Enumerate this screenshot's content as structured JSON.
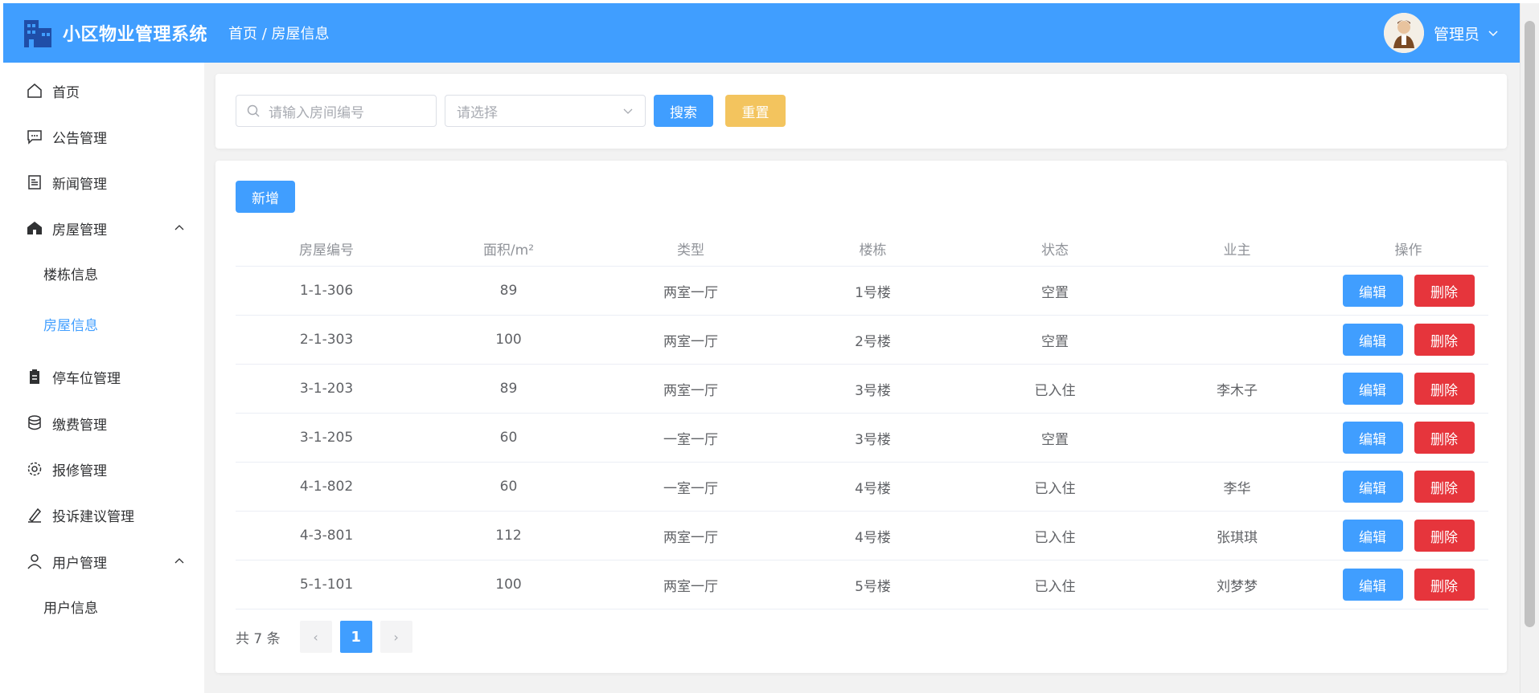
{
  "app": {
    "title": "小区物业管理系统",
    "breadcrumb": "首页 / 房屋信息",
    "user": "管理员",
    "brand_color": "#409eff"
  },
  "sidebar": {
    "items": [
      {
        "label": "首页",
        "icon": "home-icon"
      },
      {
        "label": "公告管理",
        "icon": "chat-icon"
      },
      {
        "label": "新闻管理",
        "icon": "document-icon"
      },
      {
        "label": "房屋管理",
        "icon": "house-icon",
        "expanded": true
      },
      {
        "label": "楼栋信息"
      },
      {
        "label": "房屋信息",
        "active": true
      },
      {
        "label": "停车位管理",
        "icon": "clipboard-icon"
      },
      {
        "label": "缴费管理",
        "icon": "coins-icon"
      },
      {
        "label": "报修管理",
        "icon": "gear-icon"
      },
      {
        "label": "投诉建议管理",
        "icon": "pen-icon"
      },
      {
        "label": "用户管理",
        "icon": "user-icon",
        "expanded": true
      },
      {
        "label": "用户信息"
      }
    ]
  },
  "search": {
    "room_placeholder": "请输入房间编号",
    "select_placeholder": "请选择",
    "search_label": "搜索",
    "reset_label": "重置"
  },
  "toolbar": {
    "add_label": "新增"
  },
  "table": {
    "headers": [
      "房屋编号",
      "面积/m²",
      "类型",
      "楼栋",
      "状态",
      "业主",
      "操作"
    ],
    "edit_label": "编辑",
    "delete_label": "删除",
    "rows": [
      [
        "1-1-306",
        "89",
        "两室一厅",
        "1号楼",
        "空置",
        ""
      ],
      [
        "2-1-303",
        "100",
        "两室一厅",
        "2号楼",
        "空置",
        ""
      ],
      [
        "3-1-203",
        "89",
        "两室一厅",
        "3号楼",
        "已入住",
        "李木子"
      ],
      [
        "3-1-205",
        "60",
        "一室一厅",
        "3号楼",
        "空置",
        ""
      ],
      [
        "4-1-802",
        "60",
        "一室一厅",
        "4号楼",
        "已入住",
        "李华"
      ],
      [
        "4-3-801",
        "112",
        "两室一厅",
        "4号楼",
        "已入住",
        "张琪琪"
      ],
      [
        "5-1-101",
        "100",
        "两室一厅",
        "5号楼",
        "已入住",
        "刘梦梦"
      ]
    ]
  },
  "pagination": {
    "total": "共 7 条",
    "current": "1",
    "prev": "‹",
    "next": "›"
  }
}
